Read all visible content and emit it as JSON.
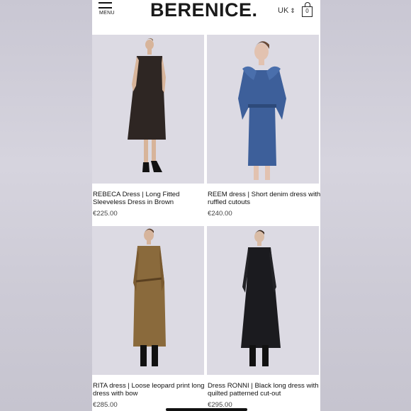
{
  "header": {
    "menu_label": "MENU",
    "logo": "BERENICE.",
    "region": "UK",
    "bag_count": "0"
  },
  "products": [
    {
      "name": "REBECA Dress | Long Fitted Sleeveless Dress in Brown",
      "price": "€225.00",
      "dress_color": "#2e2623"
    },
    {
      "name": "REEM dress | Short denim dress with ruffled cutouts",
      "price": "€240.00",
      "dress_color": "#3d5f9a"
    },
    {
      "name": "RITA dress | Loose leopard print long dress with bow",
      "price": "€285.00",
      "dress_color": "#8a6a3c"
    },
    {
      "name": "Dress RONNI | Black long dress with quilted patterned cut-out",
      "price": "€295.00",
      "dress_color": "#1b1b1f"
    }
  ],
  "colors": {
    "background": "#cfcdd8",
    "photo_background": "#d9d7e0",
    "text": "#111111"
  }
}
